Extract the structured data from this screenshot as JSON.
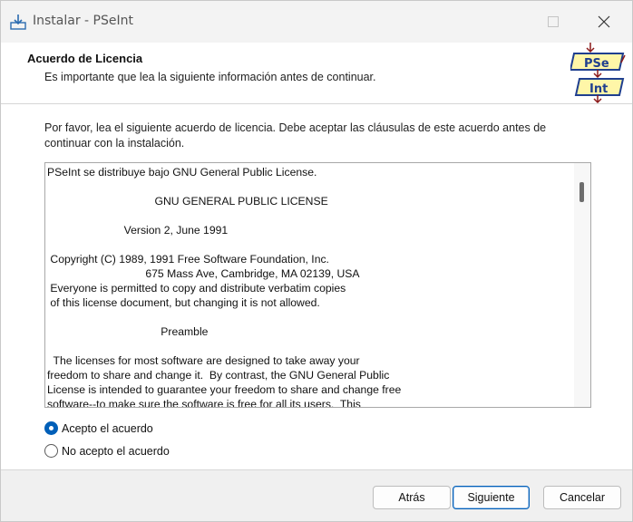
{
  "window": {
    "title": "Instalar - PSeInt"
  },
  "header": {
    "title": "Acuerdo de Licencia",
    "subtitle": "Es importante que lea la siguiente información antes de continuar.",
    "logo": {
      "top_label": "PSe",
      "bottom_label": "Int"
    }
  },
  "body": {
    "intro": "Por favor, lea el siguiente acuerdo de licencia. Debe aceptar las cláusulas de este acuerdo antes de continuar con la instalación.",
    "license_lines": [
      "PSeInt se distribuye bajo GNU General Public License.",
      "",
      "                                   GNU GENERAL PUBLIC LICENSE",
      "",
      "                         Version 2, June 1991",
      "",
      " Copyright (C) 1989, 1991 Free Software Foundation, Inc.",
      "                                675 Mass Ave, Cambridge, MA 02139, USA",
      " Everyone is permitted to copy and distribute verbatim copies",
      " of this license document, but changing it is not allowed.",
      "",
      "                                     Preamble",
      "",
      "  The licenses for most software are designed to take away your",
      "freedom to share and change it.  By contrast, the GNU General Public",
      "License is intended to guarantee your freedom to share and change free",
      "software--to make sure the software is free for all its users.  This"
    ]
  },
  "options": {
    "accept_label": "Acepto el acuerdo",
    "decline_label": "No acepto el acuerdo",
    "selected": "accept"
  },
  "buttons": {
    "back": "Atrás",
    "next": "Siguiente",
    "cancel": "Cancelar"
  },
  "colors": {
    "accent": "#005fb8"
  }
}
